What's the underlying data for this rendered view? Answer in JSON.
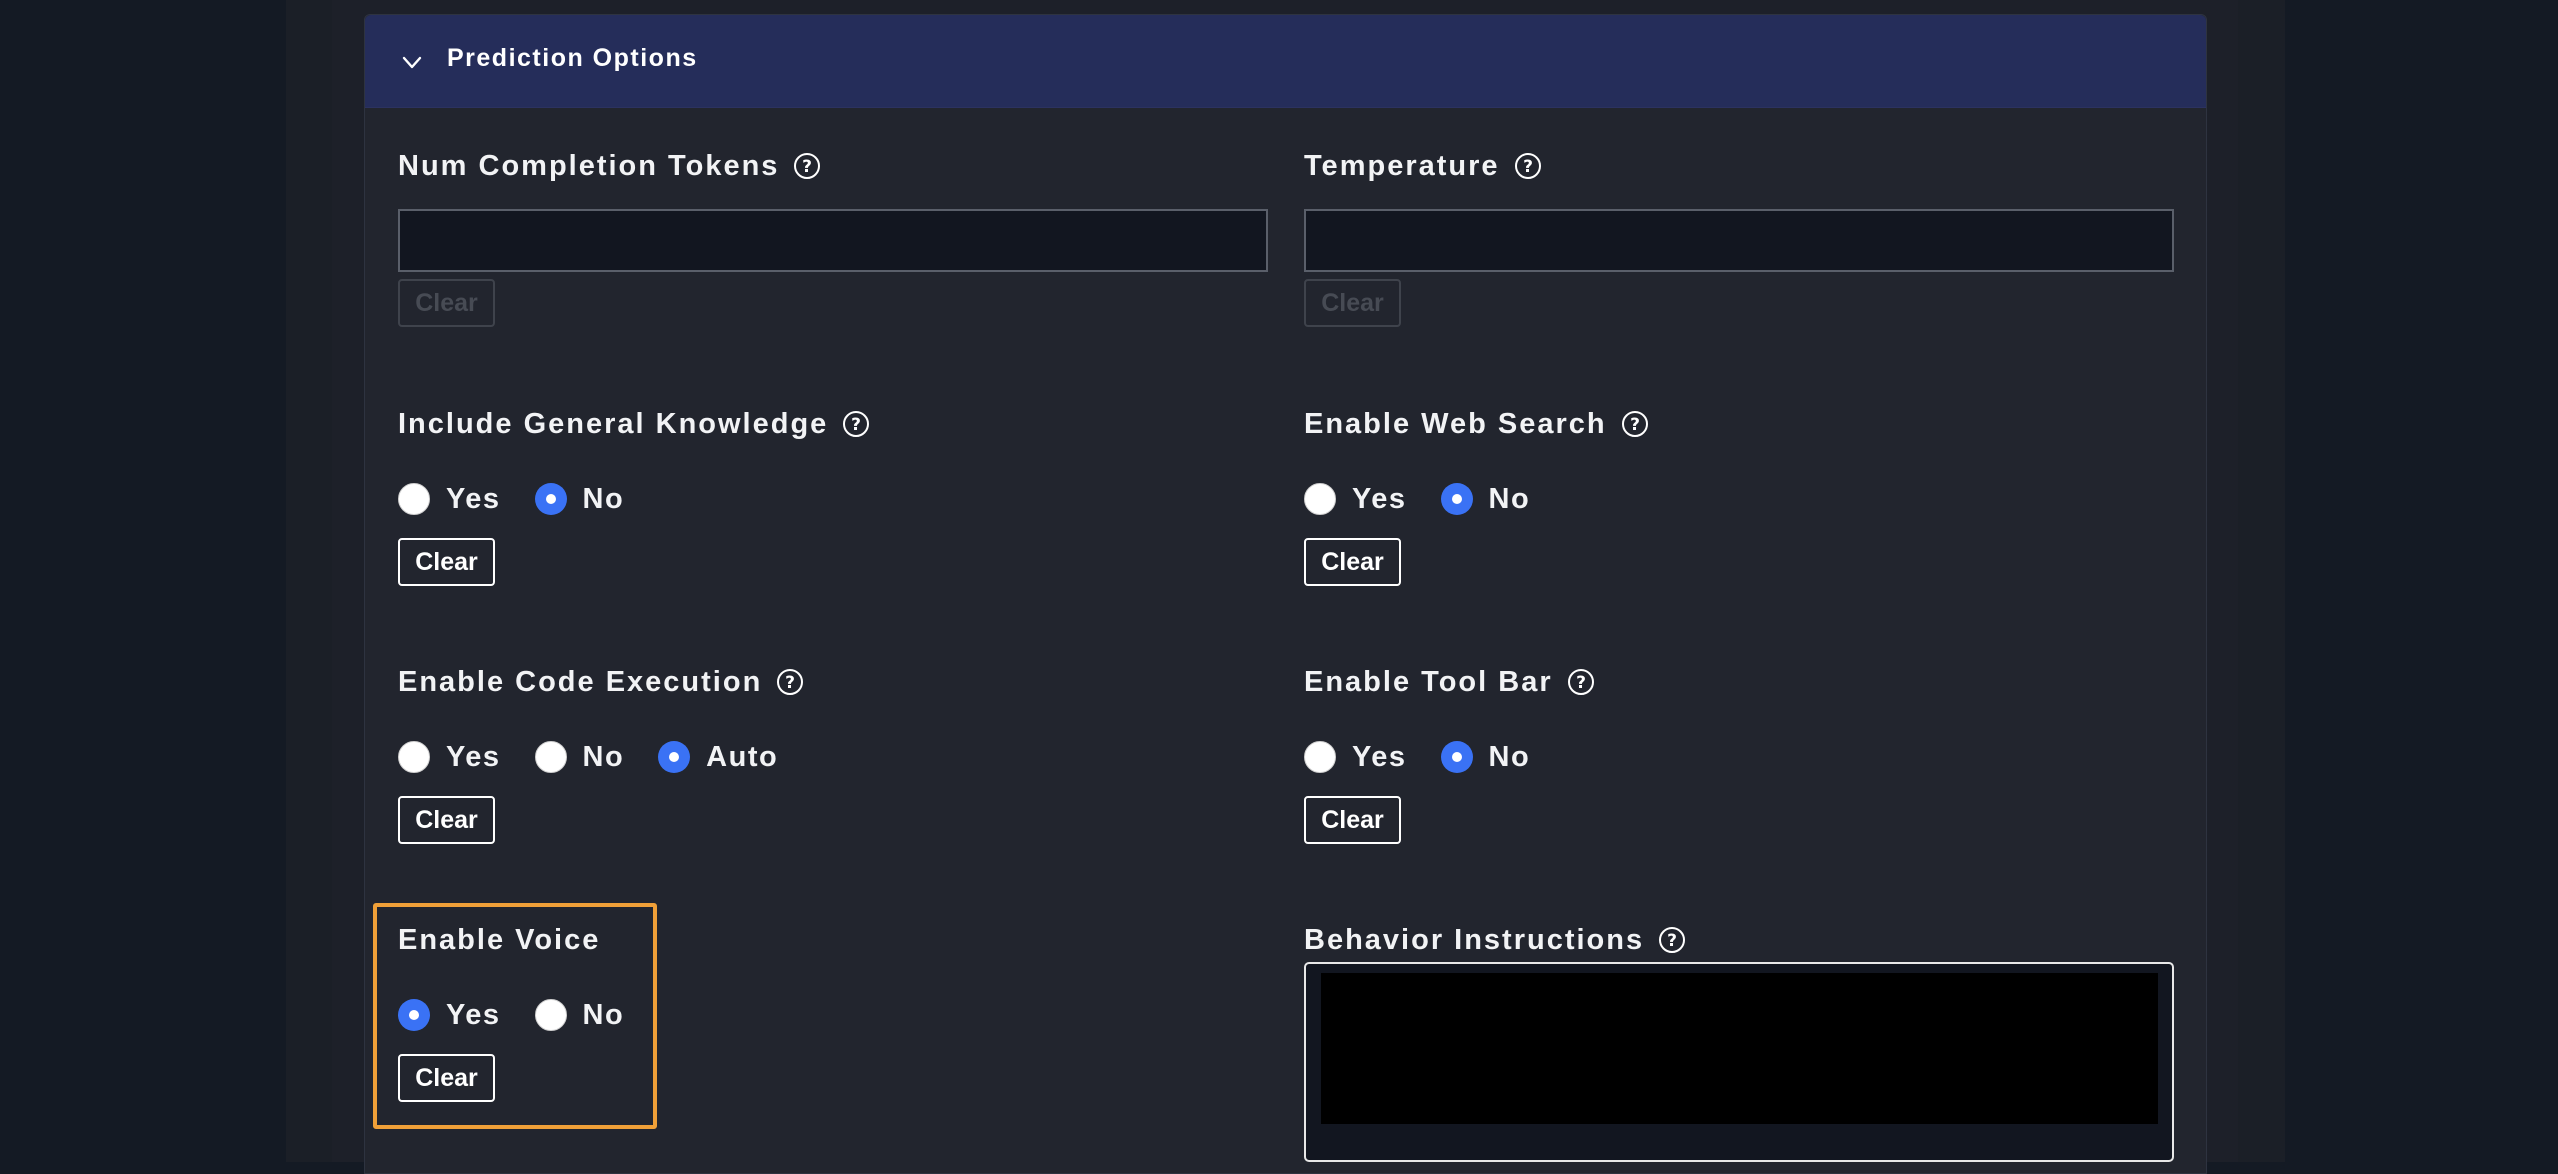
{
  "panel": {
    "title": "Prediction Options"
  },
  "fields": {
    "num_completion_tokens": {
      "label": "Num Completion Tokens",
      "value": "",
      "clear_label": "Clear"
    },
    "temperature": {
      "label": "Temperature",
      "value": "",
      "clear_label": "Clear"
    },
    "include_general_knowledge": {
      "label": "Include General Knowledge",
      "options": [
        "Yes",
        "No"
      ],
      "selected": "No",
      "clear_label": "Clear"
    },
    "enable_web_search": {
      "label": "Enable Web Search",
      "options": [
        "Yes",
        "No"
      ],
      "selected": "No",
      "clear_label": "Clear"
    },
    "enable_code_execution": {
      "label": "Enable Code Execution",
      "options": [
        "Yes",
        "No",
        "Auto"
      ],
      "selected": "Auto",
      "clear_label": "Clear"
    },
    "enable_tool_bar": {
      "label": "Enable Tool Bar",
      "options": [
        "Yes",
        "No"
      ],
      "selected": "No",
      "clear_label": "Clear"
    },
    "enable_voice": {
      "label": "Enable Voice",
      "options": [
        "Yes",
        "No"
      ],
      "selected": "Yes",
      "clear_label": "Clear"
    },
    "behavior_instructions": {
      "label": "Behavior Instructions",
      "value": ""
    }
  },
  "icons": {
    "collapse": "chevron-down-icon",
    "help": "question-circle-icon"
  },
  "colors": {
    "page_bg": "#141a24",
    "card_bg": "#22252e",
    "header_bg": "#252d5a",
    "radio_checked": "#3a72f5",
    "highlight": "#f0a038"
  }
}
